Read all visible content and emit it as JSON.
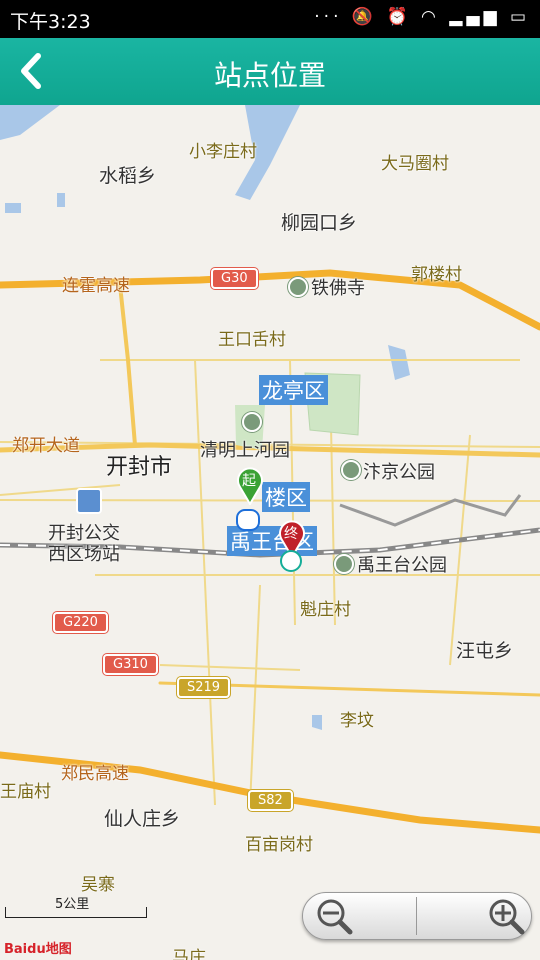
{
  "status_bar": {
    "time": "下午3:23",
    "icons": [
      "more-icon",
      "mute-icon",
      "alarm-icon",
      "wifi-icon",
      "signal-icon",
      "battery-icon"
    ]
  },
  "title_bar": {
    "title": "站点位置",
    "back_icon": "chevron-left-icon"
  },
  "map": {
    "places": {
      "xiaolizhuang": "小李庄村",
      "dama": "大马圈村",
      "shuidao": "水稻乡",
      "liuyuankou": "柳园口乡",
      "tiefosi": "铁佛寺",
      "guolou": "郭楼村",
      "wangkoushe": "王口舌村",
      "longting": "龙亭区",
      "qingming": "清明上河园",
      "kaifeng": "开封市",
      "bianjing": "汴京公园",
      "gulou": "楼区",
      "yuwang_district": "禹王台区",
      "kaifeng_bus1": "开封公交",
      "kaifeng_bus2": "西区场站",
      "yuwangtai": "禹王台公园",
      "kuizhuang": "魁庄村",
      "wangtun": "汪屯乡",
      "ligou": "李坟",
      "wangmiao": "王庙村",
      "xianrenzhuang": "仙人庄乡",
      "baimiaogang": "百亩岗村",
      "wuzhai": "吴寨",
      "mazhuang": "马庄"
    },
    "roads": {
      "lianhuo": "连霍高速",
      "zhengkai": "郑开大道",
      "zhengmin": "郑民高速"
    },
    "shields": {
      "g30": "G30",
      "g220": "G220",
      "g310": "G310",
      "s219": "S219",
      "s82": "S82"
    },
    "markers": {
      "start": "起",
      "end": "终"
    },
    "scale": "5公里",
    "logo": "Baidu地图",
    "colors": {
      "accent": "#14ad98",
      "start_pin": "#3aa235",
      "end_pin": "#c0202a",
      "district_bg": "#4a90d9"
    }
  },
  "zoom": {
    "out_icon": "zoom-out-icon",
    "in_icon": "zoom-in-icon"
  }
}
